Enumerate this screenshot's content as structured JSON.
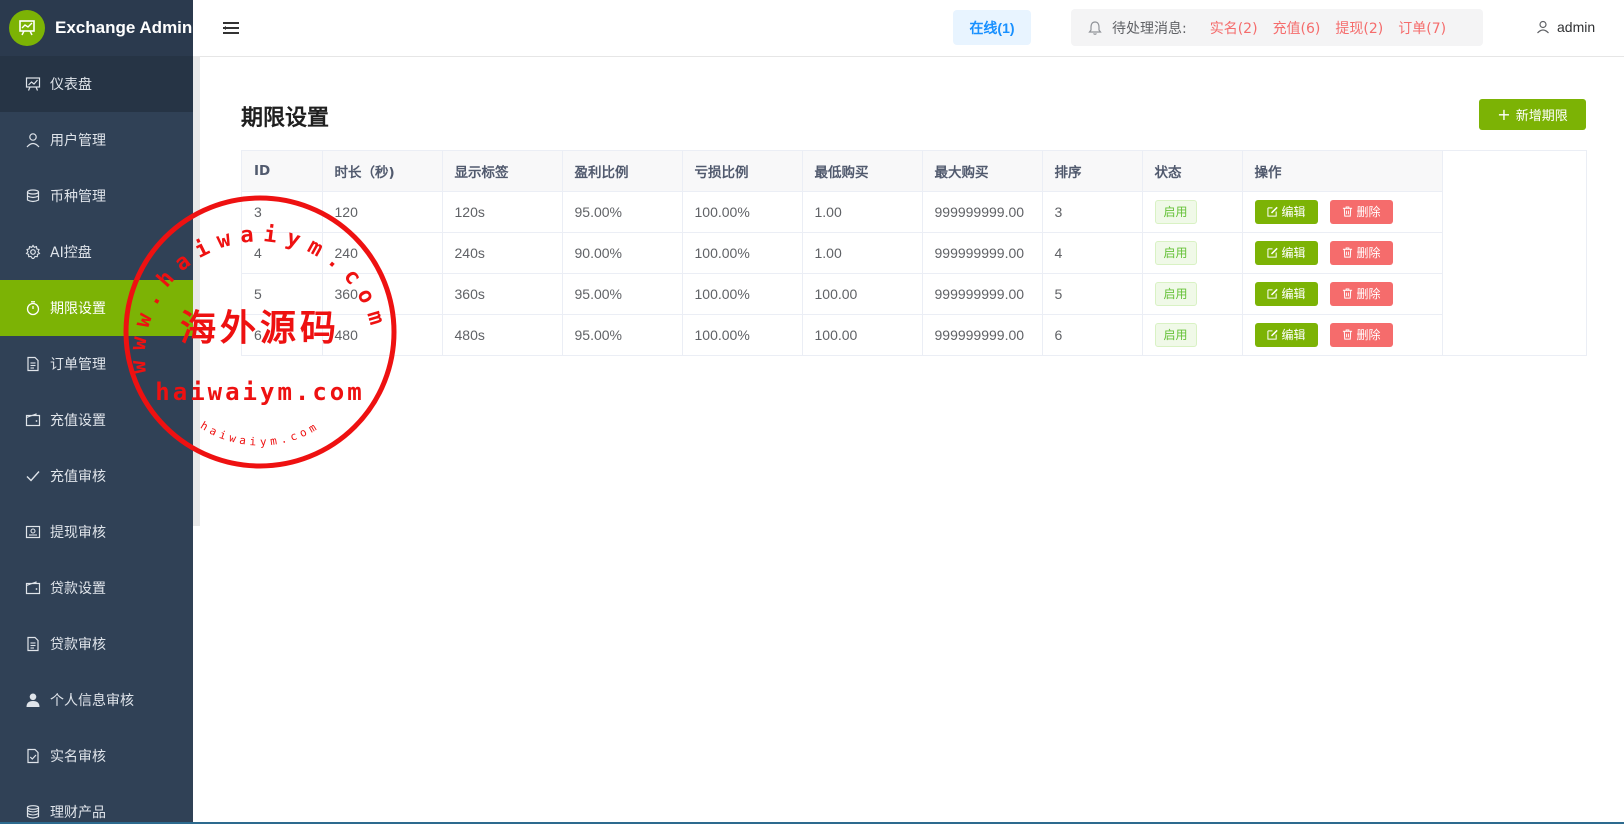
{
  "app": {
    "title": "Exchange Admin"
  },
  "sidebar": {
    "items": [
      {
        "label": "仪表盘",
        "icon": "chart-board-icon"
      },
      {
        "label": "用户管理",
        "icon": "user-icon"
      },
      {
        "label": "币种管理",
        "icon": "database-icon"
      },
      {
        "label": "AI控盘",
        "icon": "gear-icon"
      },
      {
        "label": "期限设置",
        "icon": "stopwatch-icon"
      },
      {
        "label": "订单管理",
        "icon": "document-icon"
      },
      {
        "label": "充值设置",
        "icon": "wallet-icon"
      },
      {
        "label": "充值审核",
        "icon": "check-icon"
      },
      {
        "label": "提现审核",
        "icon": "picture-icon"
      },
      {
        "label": "贷款设置",
        "icon": "wallet-icon"
      },
      {
        "label": "贷款审核",
        "icon": "document-icon"
      },
      {
        "label": "个人信息审核",
        "icon": "user-filled-icon"
      },
      {
        "label": "实名审核",
        "icon": "document-check-icon"
      },
      {
        "label": "理财产品",
        "icon": "coins-icon"
      }
    ]
  },
  "header": {
    "online": "在线(1)",
    "notice_label": "待处理消息:",
    "notice_links": [
      "实名(2)",
      "充值(6)",
      "提现(2)",
      "订单(7)"
    ],
    "user": "admin"
  },
  "page": {
    "title": "期限设置",
    "add_button": "新增期限"
  },
  "table": {
    "columns": [
      "ID",
      "时长（秒)",
      "显示标签",
      "盈利比例",
      "亏损比例",
      "最低购买",
      "最大购买",
      "排序",
      "状态",
      "操作"
    ],
    "rows": [
      {
        "id": "3",
        "duration": "120",
        "label": "120s",
        "profit": "95.00%",
        "loss": "100.00%",
        "min": "1.00",
        "max": "999999999.00",
        "sort": "3",
        "status": "启用"
      },
      {
        "id": "4",
        "duration": "240",
        "label": "240s",
        "profit": "90.00%",
        "loss": "100.00%",
        "min": "1.00",
        "max": "999999999.00",
        "sort": "4",
        "status": "启用"
      },
      {
        "id": "5",
        "duration": "360",
        "label": "360s",
        "profit": "95.00%",
        "loss": "100.00%",
        "min": "100.00",
        "max": "999999999.00",
        "sort": "5",
        "status": "启用"
      },
      {
        "id": "6",
        "duration": "480",
        "label": "480s",
        "profit": "95.00%",
        "loss": "100.00%",
        "min": "100.00",
        "max": "999999999.00",
        "sort": "6",
        "status": "启用"
      }
    ],
    "edit_label": "编辑",
    "delete_label": "删除"
  },
  "watermark": {
    "top_arc": "www.haiwaiym.com",
    "center": "海外源码",
    "bottom_line": "haiwaiym.com",
    "small_arc": "haiwaiym.com"
  },
  "colors": {
    "sidebar_bg": "#304156",
    "accent": "#7cb305",
    "danger": "#f56c6c",
    "stamp": "#ee1111"
  }
}
